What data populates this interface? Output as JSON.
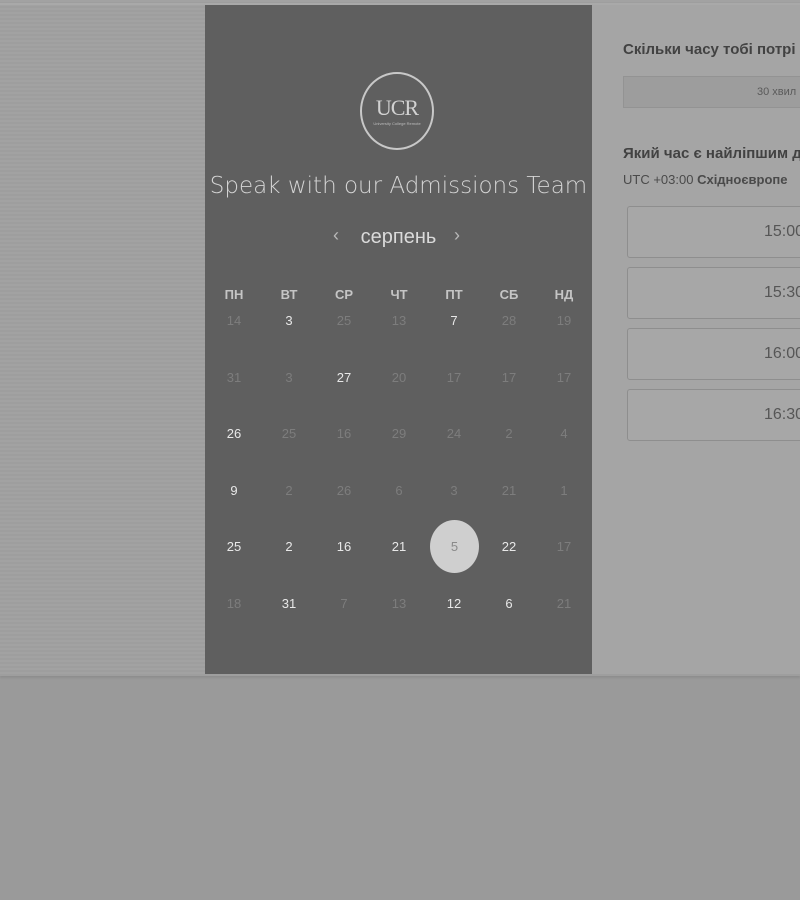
{
  "header": {
    "logo_text": "UCR",
    "logo_subtitle": "University College Remote",
    "title": "Speak with our Admissions Team"
  },
  "calendar": {
    "month": "серпень",
    "prev_icon": "‹",
    "next_icon": "›",
    "weekdays": [
      "ПН",
      "ВТ",
      "СР",
      "ЧТ",
      "ПТ",
      "СБ",
      "НД"
    ],
    "weeks": [
      [
        {
          "d": "14",
          "a": false
        },
        {
          "d": "3",
          "a": true
        },
        {
          "d": "25",
          "a": false
        },
        {
          "d": "13",
          "a": false
        },
        {
          "d": "7",
          "a": true
        },
        {
          "d": "28",
          "a": false
        },
        {
          "d": "19",
          "a": false
        }
      ],
      [
        {
          "d": "31",
          "a": false
        },
        {
          "d": "3",
          "a": false
        },
        {
          "d": "27",
          "a": true
        },
        {
          "d": "20",
          "a": false
        },
        {
          "d": "17",
          "a": false
        },
        {
          "d": "17",
          "a": false
        },
        {
          "d": "17",
          "a": false
        }
      ],
      [
        {
          "d": "26",
          "a": true
        },
        {
          "d": "25",
          "a": false
        },
        {
          "d": "16",
          "a": false
        },
        {
          "d": "29",
          "a": false
        },
        {
          "d": "24",
          "a": false
        },
        {
          "d": "2",
          "a": false
        },
        {
          "d": "4",
          "a": false
        }
      ],
      [
        {
          "d": "9",
          "a": true
        },
        {
          "d": "2",
          "a": false
        },
        {
          "d": "26",
          "a": false
        },
        {
          "d": "6",
          "a": false
        },
        {
          "d": "3",
          "a": false
        },
        {
          "d": "21",
          "a": false
        },
        {
          "d": "1",
          "a": false
        }
      ],
      [
        {
          "d": "25",
          "a": true
        },
        {
          "d": "2",
          "a": true
        },
        {
          "d": "16",
          "a": true
        },
        {
          "d": "21",
          "a": true
        },
        {
          "d": "5",
          "a": true,
          "sel": true
        },
        {
          "d": "22",
          "a": true
        },
        {
          "d": "17",
          "a": false
        }
      ],
      [
        {
          "d": "18",
          "a": false
        },
        {
          "d": "31",
          "a": true
        },
        {
          "d": "7",
          "a": false
        },
        {
          "d": "13",
          "a": false
        },
        {
          "d": "12",
          "a": true
        },
        {
          "d": "6",
          "a": true
        },
        {
          "d": "21",
          "a": false
        }
      ]
    ]
  },
  "booking": {
    "duration_question": "Скільки часу тобі потрі",
    "duration_value": "30 хвил",
    "time_question": "Який час є найліпшим д",
    "timezone_offset": "UTC +03:00",
    "timezone_name": "Східноєвропе",
    "slots": [
      "15:00",
      "15:30",
      "16:00",
      "16:30"
    ]
  },
  "colors": {
    "page_bg": "#9a9a9a",
    "left_panel": "#5f5f5f",
    "right_panel": "#a5a5a5",
    "selected_day": "#cfcfcf"
  }
}
